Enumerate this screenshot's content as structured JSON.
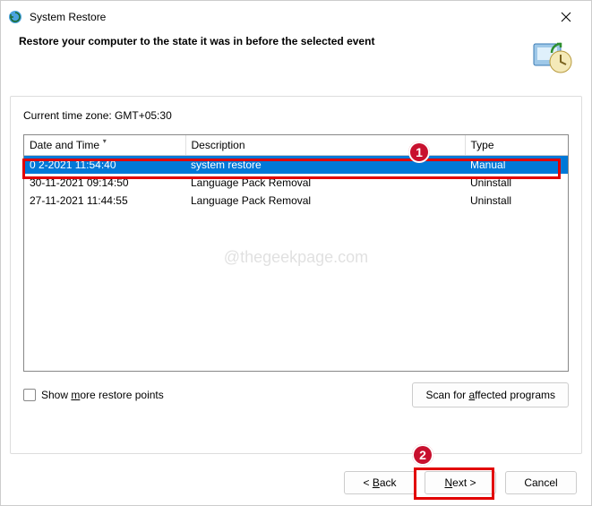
{
  "window": {
    "title": "System Restore"
  },
  "header": {
    "heading": "Restore your computer to the state it was in before the selected event"
  },
  "timezone_label": "Current time zone: GMT+05:30",
  "table": {
    "columns": {
      "date": "Date and Time",
      "desc": "Description",
      "type": "Type"
    },
    "rows": [
      {
        "date": "0    2-2021 11:54:40",
        "desc": "system restore",
        "type": "Manual",
        "selected": true
      },
      {
        "date": "30-11-2021 09:14:50",
        "desc": "Language Pack Removal",
        "type": "Uninstall",
        "selected": false
      },
      {
        "date": "27-11-2021 11:44:55",
        "desc": "Language Pack Removal",
        "type": "Uninstall",
        "selected": false
      }
    ]
  },
  "watermark": "@thegeekpage.com",
  "show_more_label_pre": "Show ",
  "show_more_label_u": "m",
  "show_more_label_post": "ore restore points",
  "scan_pre": "Scan for ",
  "scan_u": "a",
  "scan_post": "ffected programs",
  "buttons": {
    "back_pre": "< ",
    "back_u": "B",
    "back_post": "ack",
    "next_u": "N",
    "next_post": "ext >",
    "cancel": "Cancel"
  },
  "annotations": {
    "badge1": "1",
    "badge2": "2"
  }
}
